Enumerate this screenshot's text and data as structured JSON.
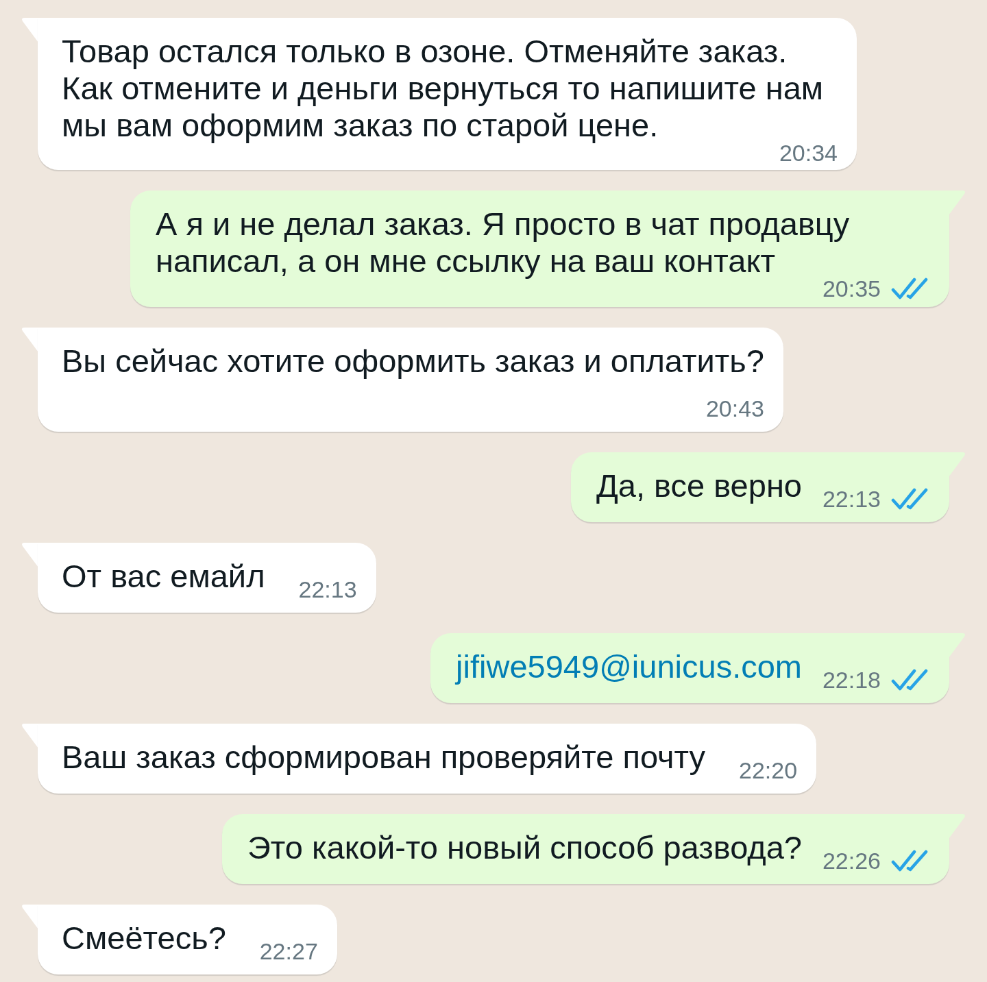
{
  "messages": [
    {
      "outgoing": false,
      "kind": "text",
      "text": "Товар остался только в озоне. Отменяйте заказ. Как отмените и деньги вернуться то напишите нам мы вам оформим заказ по старой цене.",
      "time": "20:34"
    },
    {
      "outgoing": true,
      "kind": "text",
      "text": "А я и не делал заказ. Я просто в чат продавцу написал, а он мне ссылку на ваш контакт",
      "time": "20:35",
      "read": true
    },
    {
      "outgoing": false,
      "kind": "text",
      "text": "Вы сейчас хотите оформить заказ и оплатить?",
      "time": "20:43"
    },
    {
      "outgoing": true,
      "kind": "text",
      "text": "Да, все верно",
      "time": "22:13",
      "read": true
    },
    {
      "outgoing": false,
      "kind": "text",
      "text": "От вас емайл",
      "time": "22:13"
    },
    {
      "outgoing": true,
      "kind": "link",
      "text": "jifiwe5949@iunicus.com",
      "time": "22:18",
      "read": true
    },
    {
      "outgoing": false,
      "kind": "text",
      "text": "Ваш заказ сформирован проверяйте почту",
      "time": "22:20"
    },
    {
      "outgoing": true,
      "kind": "text",
      "text": "Это какой-то новый способ развода?",
      "time": "22:26",
      "read": true
    },
    {
      "outgoing": false,
      "kind": "text",
      "text": "Смеётесь?",
      "time": "22:27"
    }
  ]
}
